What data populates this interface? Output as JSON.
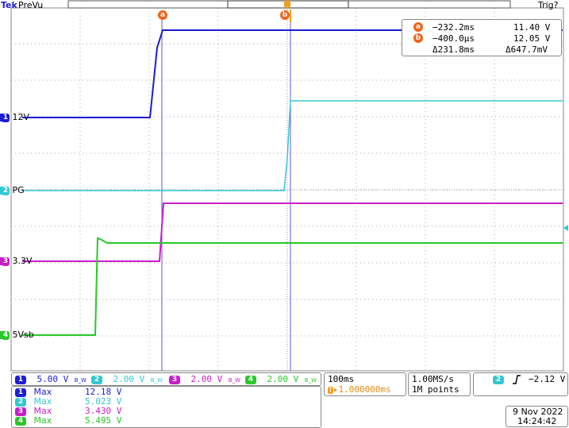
{
  "header": {
    "brand": "Tek",
    "mode": "PreVu",
    "trigger_status": "Trig?"
  },
  "cursors": {
    "a_label": "a",
    "b_label": "b",
    "a_time": "−232.2ms",
    "a_value": "11.40 V",
    "b_time": "−400.0µs",
    "b_value": "12.05 V",
    "delta_time": "Δ231.8ms",
    "delta_value": "Δ647.7mV"
  },
  "channel_labels": [
    {
      "num": "1",
      "label": "12V",
      "color": "#1c1cd4"
    },
    {
      "num": "2",
      "label": "PG",
      "color": "#32c8d2"
    },
    {
      "num": "3",
      "label": "3.3V",
      "color": "#c81ec8"
    },
    {
      "num": "4",
      "label": "5Vsb",
      "color": "#28c828"
    }
  ],
  "scales": [
    {
      "num": "1",
      "value": "5.00 V",
      "bw": "B_W",
      "color": "#1c1cd4"
    },
    {
      "num": "2",
      "value": "2.00 V",
      "bw": "B_W",
      "color": "#32c8d2"
    },
    {
      "num": "3",
      "value": "2.00 V",
      "bw": "B_W",
      "color": "#c81ec8"
    },
    {
      "num": "4",
      "value": "2.00 V",
      "bw": "B_W",
      "color": "#28c828"
    }
  ],
  "timebase": {
    "scale": "100ms",
    "position": "▸1.000000ms",
    "sample_rate": "1.00MS/s",
    "record_length": "1M points"
  },
  "trigger": {
    "channel": "2",
    "slope_icon": "rising-edge-icon",
    "level": "−2.12 V"
  },
  "measurements": [
    {
      "num": "1",
      "name": "Max",
      "value": "12.18 V",
      "color": "#1c1cd4"
    },
    {
      "num": "2",
      "name": "Max",
      "value": "5.023 V",
      "color": "#32c8d2"
    },
    {
      "num": "3",
      "name": "Max",
      "value": "3.430 V",
      "color": "#c81ec8"
    },
    {
      "num": "4",
      "name": "Max",
      "value": "5.495 V",
      "color": "#28c828"
    }
  ],
  "datetime": {
    "date": "9 Nov 2022",
    "time": "14:24:42"
  },
  "colors": {
    "ch1": "#1c1cd4",
    "ch2": "#32c8d2",
    "ch3": "#c81ec8",
    "ch4": "#28c828",
    "cursor": "#f0641e",
    "trigger": "#f0a020"
  }
}
